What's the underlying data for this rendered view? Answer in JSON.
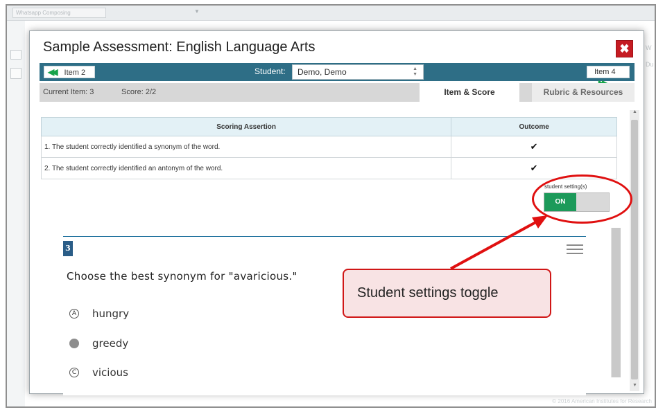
{
  "background": {
    "dropdown_text": "Whatsapp Composing",
    "right_text_1": "W",
    "right_text_2": "Du",
    "footer": "© 2016 American Institutes for Research"
  },
  "modal": {
    "title": "Sample Assessment: English Language Arts",
    "close_symbol": "✖"
  },
  "nav": {
    "prev_label": "Item 2",
    "next_label": "Item 4",
    "student_label": "Student:",
    "student_value": "Demo, Demo"
  },
  "info": {
    "current_item": "Current Item: 3",
    "score": "Score: 2/2"
  },
  "tabs": [
    {
      "label": "Item & Score",
      "active": true
    },
    {
      "label": "Rubric & Resources",
      "active": false
    }
  ],
  "score_table": {
    "headers": [
      "Scoring Assertion",
      "Outcome"
    ],
    "rows": [
      {
        "assertion": "1. The student correctly identified a synonym of the word.",
        "outcome": "✔"
      },
      {
        "assertion": "2. The student correctly identified an antonym of the word.",
        "outcome": "✔"
      }
    ]
  },
  "student_settings": {
    "label": "student setting(s)",
    "toggle_label": "ON",
    "state": "on"
  },
  "item": {
    "number": "3",
    "question": "Choose the best synonym for \"avaricious.\"",
    "options": [
      {
        "marker": "A",
        "text": "hungry",
        "selected": false
      },
      {
        "marker": "B",
        "text": "greedy",
        "selected": true
      },
      {
        "marker": "C",
        "text": "vicious",
        "selected": false
      }
    ]
  },
  "annotation": {
    "label": "Student settings toggle",
    "color": "#e01010"
  },
  "colors": {
    "nav_bar": "#2e6e86",
    "close_button": "#c51b22",
    "toggle_on": "#1c9a5a",
    "table_header": "#e3f1f6"
  }
}
